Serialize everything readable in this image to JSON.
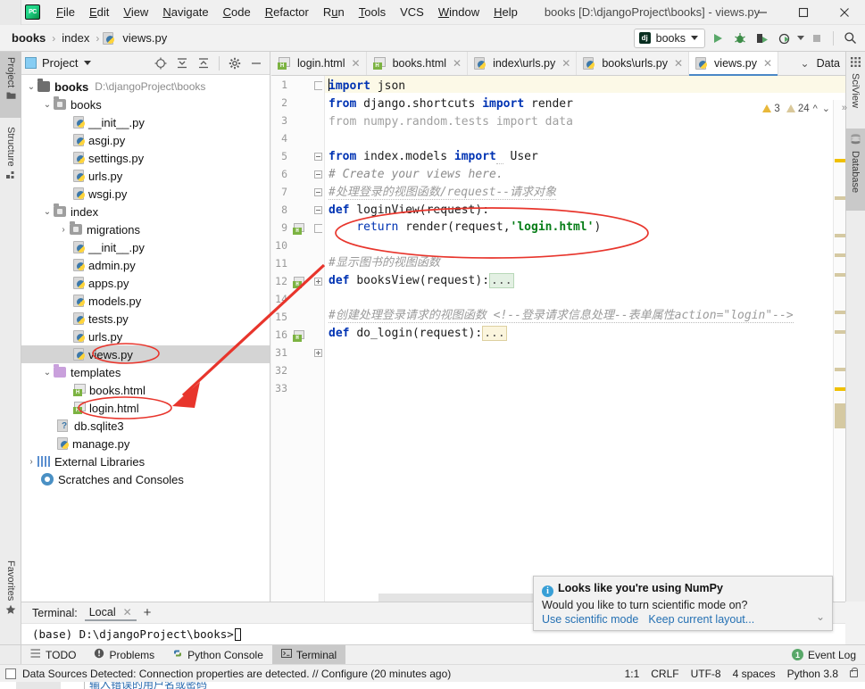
{
  "window": {
    "title": "books [D:\\djangoProject\\books] - views.py",
    "app_icon": "pycharm-logo-icon",
    "minimize": "minimize-icon",
    "maximize": "maximize-icon",
    "close": "close-icon"
  },
  "menu": {
    "items": [
      {
        "label": "File",
        "mnemonic": "F"
      },
      {
        "label": "Edit",
        "mnemonic": "E"
      },
      {
        "label": "View",
        "mnemonic": "V"
      },
      {
        "label": "Navigate",
        "mnemonic": "N"
      },
      {
        "label": "Code",
        "mnemonic": "C"
      },
      {
        "label": "Refactor",
        "mnemonic": "R"
      },
      {
        "label": "Run",
        "mnemonic": "u"
      },
      {
        "label": "Tools",
        "mnemonic": "T"
      },
      {
        "label": "VCS",
        "mnemonic": ""
      },
      {
        "label": "Window",
        "mnemonic": "W"
      },
      {
        "label": "Help",
        "mnemonic": "H"
      }
    ]
  },
  "breadcrumb": {
    "items": [
      "books",
      "index",
      "views.py"
    ],
    "separator": "›"
  },
  "toolbar": {
    "run_config": "books",
    "run_config_icon": "django-icon",
    "run": "run-icon",
    "debug": "debug-icon",
    "run_coverage": "run-with-coverage-icon",
    "profile": "profile-icon",
    "stop": "stop-icon",
    "search": "search-icon"
  },
  "left_strip": {
    "tabs": [
      {
        "label": "Project",
        "icon": "folder-icon",
        "active": true
      },
      {
        "label": "Structure",
        "icon": "structure-icon",
        "active": false
      },
      {
        "label": "Favorites",
        "icon": "star-icon",
        "active": false
      }
    ]
  },
  "right_strip": {
    "tabs": [
      {
        "label": "SciView",
        "icon": "grid-icon",
        "active": false
      },
      {
        "label": "Database",
        "icon": "database-icon",
        "active": true
      }
    ]
  },
  "project_panel": {
    "title": "Project",
    "title_icon": "project-view-icon",
    "dropdown_icon": "chevron-down-icon",
    "tools": [
      "locate-icon",
      "expand-all-icon",
      "collapse-all-icon",
      "gear-icon",
      "hide-icon"
    ],
    "tree": [
      {
        "label": "books",
        "path": "D:\\djangoProject\\books",
        "depth": 0,
        "twist": "⌄",
        "icon": "folder-root",
        "bold": true,
        "selected": false
      },
      {
        "label": "books",
        "path": "",
        "depth": 1,
        "twist": "⌄",
        "icon": "folder-source",
        "bold": false,
        "selected": false
      },
      {
        "label": "__init__.py",
        "path": "",
        "depth": 2,
        "twist": "",
        "icon": "python-file",
        "bold": false,
        "selected": false
      },
      {
        "label": "asgi.py",
        "path": "",
        "depth": 2,
        "twist": "",
        "icon": "python-file",
        "bold": false,
        "selected": false
      },
      {
        "label": "settings.py",
        "path": "",
        "depth": 2,
        "twist": "",
        "icon": "python-file",
        "bold": false,
        "selected": false
      },
      {
        "label": "urls.py",
        "path": "",
        "depth": 2,
        "twist": "",
        "icon": "python-file",
        "bold": false,
        "selected": false
      },
      {
        "label": "wsgi.py",
        "path": "",
        "depth": 2,
        "twist": "",
        "icon": "python-file",
        "bold": false,
        "selected": false
      },
      {
        "label": "index",
        "path": "",
        "depth": 1,
        "twist": "⌄",
        "icon": "folder-source",
        "bold": false,
        "selected": false
      },
      {
        "label": "migrations",
        "path": "",
        "depth": 2,
        "twist": "›",
        "icon": "folder-source",
        "bold": false,
        "selected": false
      },
      {
        "label": "__init__.py",
        "path": "",
        "depth": 2,
        "twist": "",
        "icon": "python-file",
        "bold": false,
        "selected": false
      },
      {
        "label": "admin.py",
        "path": "",
        "depth": 2,
        "twist": "",
        "icon": "python-file",
        "bold": false,
        "selected": false
      },
      {
        "label": "apps.py",
        "path": "",
        "depth": 2,
        "twist": "",
        "icon": "python-file",
        "bold": false,
        "selected": false
      },
      {
        "label": "models.py",
        "path": "",
        "depth": 2,
        "twist": "",
        "icon": "python-file",
        "bold": false,
        "selected": false
      },
      {
        "label": "tests.py",
        "path": "",
        "depth": 2,
        "twist": "",
        "icon": "python-file",
        "bold": false,
        "selected": false
      },
      {
        "label": "urls.py",
        "path": "",
        "depth": 2,
        "twist": "",
        "icon": "python-file",
        "bold": false,
        "selected": false
      },
      {
        "label": "views.py",
        "path": "",
        "depth": 2,
        "twist": "",
        "icon": "python-file",
        "bold": false,
        "selected": true
      },
      {
        "label": "templates",
        "path": "",
        "depth": 1,
        "twist": "⌄",
        "icon": "folder-template",
        "bold": false,
        "selected": false
      },
      {
        "label": "books.html",
        "path": "",
        "depth": 2,
        "twist": "",
        "icon": "html-file",
        "bold": false,
        "selected": false
      },
      {
        "label": "login.html",
        "path": "",
        "depth": 2,
        "twist": "",
        "icon": "html-file",
        "bold": false,
        "selected": false
      },
      {
        "label": "db.sqlite3",
        "path": "",
        "depth": 1,
        "twist": "",
        "icon": "db-file",
        "bold": false,
        "selected": false
      },
      {
        "label": "manage.py",
        "path": "",
        "depth": 1,
        "twist": "",
        "icon": "python-file",
        "bold": false,
        "selected": false
      },
      {
        "label": "External Libraries",
        "path": "",
        "depth": 0,
        "twist": "›",
        "icon": "library-icon",
        "bold": false,
        "selected": false
      },
      {
        "label": "Scratches and Consoles",
        "path": "",
        "depth": 0,
        "twist": "",
        "icon": "scratches-icon",
        "bold": false,
        "selected": false
      }
    ]
  },
  "editor": {
    "tabs": [
      {
        "label": "login.html",
        "icon": "html-file",
        "active": false
      },
      {
        "label": "books.html",
        "icon": "html-file",
        "active": false
      },
      {
        "label": "index\\urls.py",
        "icon": "python-file",
        "active": false
      },
      {
        "label": "books\\urls.py",
        "icon": "python-file",
        "active": false
      },
      {
        "label": "views.py",
        "icon": "python-file",
        "active": true
      }
    ],
    "overflow_icon": "chevron-down-icon",
    "data_tab_label": "Data",
    "inspections": {
      "error_count": "3",
      "warning_count": "24",
      "up_icon": "chevron-up-icon",
      "down_icon": "chevron-down-icon",
      "more_icon": "more-icon"
    },
    "line_numbers": [
      "1",
      "2",
      "3",
      "4",
      "5",
      "6",
      "7",
      "8",
      "9",
      "10",
      "11",
      "12",
      "14",
      "15",
      "16",
      "31",
      "32",
      "33"
    ],
    "code_lines": [
      {
        "n": "1",
        "text": "import json"
      },
      {
        "n": "2",
        "text": "from django.shortcuts import render"
      },
      {
        "n": "3",
        "text": "from numpy.random.tests import data"
      },
      {
        "n": "4",
        "text": ""
      },
      {
        "n": "5",
        "text": "from index.models import  User"
      },
      {
        "n": "6",
        "text": "# Create your views here."
      },
      {
        "n": "7",
        "text": "#处理登录的视图函数/request--请求对象"
      },
      {
        "n": "8",
        "text": "def loginView(request):"
      },
      {
        "n": "9",
        "text": "    return render(request,'login.html')"
      },
      {
        "n": "10",
        "text": ""
      },
      {
        "n": "11",
        "text": "#显示图书的视图函数"
      },
      {
        "n": "12",
        "text": "def booksView(request):..."
      },
      {
        "n": "14",
        "text": ""
      },
      {
        "n": "15",
        "text": "#创建处理登录请求的视图函数 <!--登录请求信息处理--表单属性action=\"login\"-->"
      },
      {
        "n": "16",
        "text": "def do_login(request):..."
      },
      {
        "n": "31",
        "text": ""
      },
      {
        "n": "32",
        "text": ""
      },
      {
        "n": "33",
        "text": ""
      }
    ]
  },
  "notification": {
    "icon": "info-icon",
    "title": "Looks like you're using NumPy",
    "body": "Would you like to turn scientific mode on?",
    "link_primary": "Use scientific mode",
    "link_secondary": "Keep current layout...",
    "expand_icon": "chevron-down-icon"
  },
  "terminal": {
    "label": "Terminal:",
    "tab": "Local",
    "close_icon": "close-icon",
    "add_icon": "plus-icon",
    "prompt": "(base) D:\\djangoProject\\books>"
  },
  "bottom_tabs": [
    {
      "label": "TODO",
      "icon": "todo-icon",
      "active": false
    },
    {
      "label": "Problems",
      "icon": "problems-icon",
      "active": false
    },
    {
      "label": "Python Console",
      "icon": "python-console-icon",
      "active": false
    },
    {
      "label": "Terminal",
      "icon": "terminal-icon",
      "active": true
    }
  ],
  "event_log": {
    "count": "1",
    "label": "Event Log"
  },
  "status_bar": {
    "message": "Data Sources Detected: Connection properties are detected. // Configure (20 minutes ago)",
    "icon": "data-source-icon",
    "caret_position": "1:1",
    "line_separator": "CRLF",
    "encoding": "UTF-8",
    "indent": "4 spaces",
    "interpreter": "Python 3.8",
    "lock_icon": "lock-icon"
  },
  "annotations": {
    "ellipse_views_py": "red-ellipse-around-views-py",
    "ellipse_login_html": "red-ellipse-around-login-html",
    "ellipse_return_render": "red-ellipse-around-return-render",
    "arrow": "red-arrow-from-code-to-login-html"
  },
  "background_window": {
    "text": "输入错误的用户名或密码"
  },
  "colors": {
    "accent": "#4a88c7",
    "annotation_red": "#e8352c",
    "keyword_blue": "#0033b3",
    "string_green": "#067d17",
    "comment_grey": "#8c8c8c"
  }
}
